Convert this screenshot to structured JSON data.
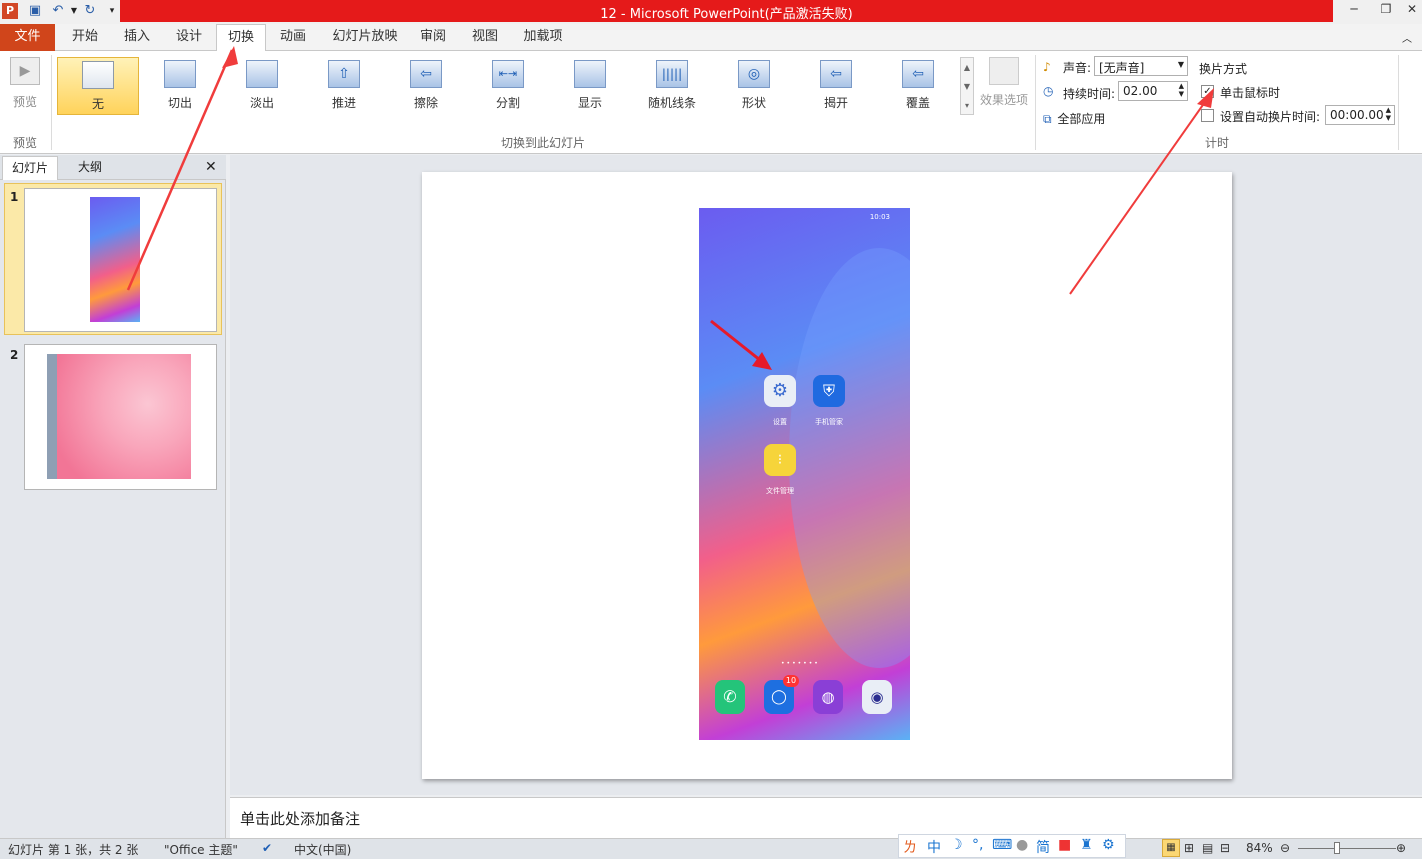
{
  "title": "12 -  Microsoft PowerPoint(产品激活失败)",
  "quick_access": {
    "app_icon": "P"
  },
  "tabs": [
    "文件",
    "开始",
    "插入",
    "设计",
    "切换",
    "动画",
    "幻灯片放映",
    "审阅",
    "视图",
    "加载项"
  ],
  "ribbon": {
    "preview_label": "预览",
    "preview_group": "预览",
    "transitions": [
      "无",
      "切出",
      "淡出",
      "推进",
      "擦除",
      "分割",
      "显示",
      "随机线条",
      "形状",
      "揭开",
      "覆盖"
    ],
    "transitions_group": "切换到此幻灯片",
    "effect_options": "效果选项",
    "sound_label": "声音:",
    "sound_value": "[无声音]",
    "duration_label": "持续时间:",
    "duration_value": "02.00",
    "apply_all": "全部应用",
    "advance_title": "换片方式",
    "on_click_label": "单击鼠标时",
    "on_click_checked": true,
    "auto_after_label": "设置自动换片时间:",
    "auto_after_value": "00:00.00",
    "auto_after_checked": false,
    "timing_group": "计时"
  },
  "left_pane": {
    "tabs": [
      "幻灯片",
      "大纲"
    ],
    "slides": [
      {
        "num": "1",
        "selected": true
      },
      {
        "num": "2",
        "selected": false
      }
    ]
  },
  "phone": {
    "status_time": "10:03",
    "apps": [
      {
        "label": "设置",
        "icon": "settings-icon"
      },
      {
        "label": "手机管家",
        "icon": "shield-icon"
      },
      {
        "label": "文件管理",
        "icon": "folder-icon"
      }
    ],
    "dock": [
      "phone-icon",
      "messages-icon",
      "browser-icon",
      "camera-icon"
    ],
    "badge": "10"
  },
  "notes_placeholder": "单击此处添加备注",
  "status": {
    "slide_info": "幻灯片 第 1 张，共 2 张",
    "theme": "\"Office 主题\"",
    "language": "中文(中国)",
    "zoom": "84%"
  },
  "ime": {
    "items": [
      "中",
      "简"
    ]
  },
  "colors": {
    "accent_red": "#e51a1a",
    "file_tab": "#d0451b",
    "selected_orange": "#ffd35b"
  }
}
